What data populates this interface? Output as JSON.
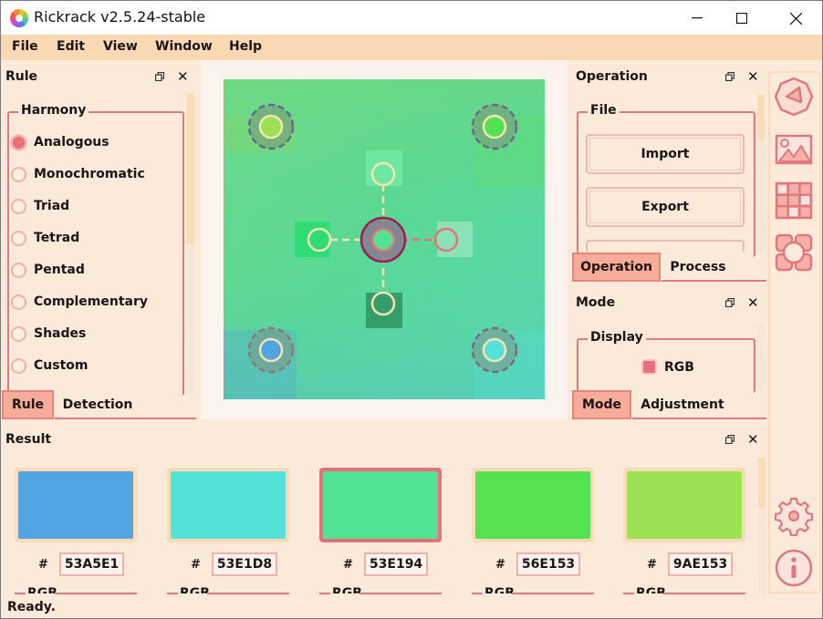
{
  "window": {
    "title": "Rickrack v2.5.24-stable",
    "minimize": "—",
    "maximize": "☐",
    "close": "✕"
  },
  "menu": [
    "File",
    "Edit",
    "View",
    "Window",
    "Help"
  ],
  "rule_panel": {
    "title": "Rule",
    "group": "Harmony",
    "options": [
      {
        "label": "Analogous",
        "checked": true
      },
      {
        "label": "Monochromatic",
        "checked": false
      },
      {
        "label": "Triad",
        "checked": false
      },
      {
        "label": "Tetrad",
        "checked": false
      },
      {
        "label": "Pentad",
        "checked": false
      },
      {
        "label": "Complementary",
        "checked": false
      },
      {
        "label": "Shades",
        "checked": false
      },
      {
        "label": "Custom",
        "checked": false
      }
    ],
    "tabs": [
      {
        "label": "Rule",
        "active": true
      },
      {
        "label": "Detection",
        "active": false
      }
    ]
  },
  "operation_panel": {
    "title": "Operation",
    "group": "File",
    "buttons": [
      "Import",
      "Export"
    ],
    "tabs": [
      {
        "label": "Operation",
        "active": true
      },
      {
        "label": "Process",
        "active": false
      }
    ]
  },
  "mode_panel": {
    "title": "Mode",
    "group": "Display",
    "option": "RGB",
    "tabs": [
      {
        "label": "Mode",
        "active": true
      },
      {
        "label": "Adjustment",
        "active": false
      }
    ]
  },
  "result_panel": {
    "title": "Result",
    "hash_symbol": "#",
    "subgroup_label": "RGB",
    "swatches": [
      {
        "hex": "53A5E1",
        "color": "#53A5E1",
        "selected": false
      },
      {
        "hex": "53E1D8",
        "color": "#53E1D8",
        "selected": false
      },
      {
        "hex": "53E194",
        "color": "#53E194",
        "selected": true
      },
      {
        "hex": "56E153",
        "color": "#56E153",
        "selected": false
      },
      {
        "hex": "9AE153",
        "color": "#9AE153",
        "selected": false
      }
    ]
  },
  "toolbar": {
    "tools": [
      "wheel-icon",
      "image-icon",
      "grid-icon",
      "board-icon"
    ],
    "bottom": [
      "settings-icon",
      "info-icon"
    ]
  },
  "status": "Ready.",
  "theme": {
    "accent": "#e07880",
    "panel_bg": "#fbeada",
    "menu_bg": "#f8d9b3",
    "active_tab": "#f6ac98"
  }
}
